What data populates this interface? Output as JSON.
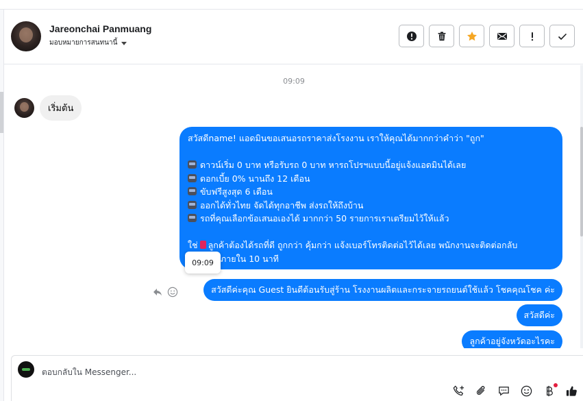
{
  "header": {
    "contact_name": "Jareonchai Panmuang",
    "assign_label": "มอบหมายการสนทนานี้"
  },
  "toolbar": {
    "buttons": [
      {
        "name": "spam",
        "icon": "alert-circle-icon"
      },
      {
        "name": "delete",
        "icon": "trash-icon"
      },
      {
        "name": "star",
        "icon": "star-icon",
        "color": "#f5a623"
      },
      {
        "name": "mark-unread",
        "icon": "envelope-icon"
      },
      {
        "name": "follow-up",
        "icon": "exclamation-icon"
      },
      {
        "name": "done",
        "icon": "checkmark-icon"
      }
    ]
  },
  "thread": {
    "timestamp": "09:09",
    "incoming": {
      "text": "เริ่มต้น"
    },
    "outgoing_long": {
      "line1": "สวัสดีname! แอดมินขอเสนอรถราคาส่งโรงงาน เราให้คุณได้มากกว่าคำว่า \"ถูก\"",
      "bullets": [
        "ดาวน์เริ่ม 0 บาท หรือรับรถ 0 บาท หารถโปรฯแบบนี้อยู่แจ้งแอดมินได้เลย",
        "ดอกเบี้ย 0% นานถึง 12 เดือน",
        "ขับฟรีสูงสุด 6 เดือน",
        "ออกได้ทั่วไทย จัดได้ทุกอาชีพ ส่งรถให้ถึงบ้าน",
        "รถที่คุณเลือกข้อเสนอเองได้ มากกว่า 50 รายการเราเตรียมไว้ให้แล้ว"
      ],
      "closing_prefix": "ใช่",
      "closing_line1": "ลูกค้าต้องได้รถที่ดี ถูกกว่า คุ้มกว่า แจ้งเบอร์โทรติดต่อไว้ได้เลย พนักงานจะติดต่อกลับ",
      "closing_line2": "ภายใน 10 นาที"
    },
    "tooltip": "09:09",
    "outgoing_short": [
      "สวัสดีค่ะคุณ Guest ยินดีต้อนรับสู่ร้าน โรงงานผลิตและกระจายรถยนต์ใช้แล้ว โชคคุณโชค ค่ะ",
      "สวัสดีค่ะ",
      "ลูกค้าอยู่จังหวัดอะไรคะ"
    ],
    "bubble_color": "#0a7cff"
  },
  "composer": {
    "placeholder": "ตอบกลับใน Messenger...",
    "icons": [
      "phone-plus-icon",
      "paperclip-icon",
      "saved-reply-icon",
      "emoji-icon",
      "baht-icon",
      "like-icon"
    ]
  }
}
